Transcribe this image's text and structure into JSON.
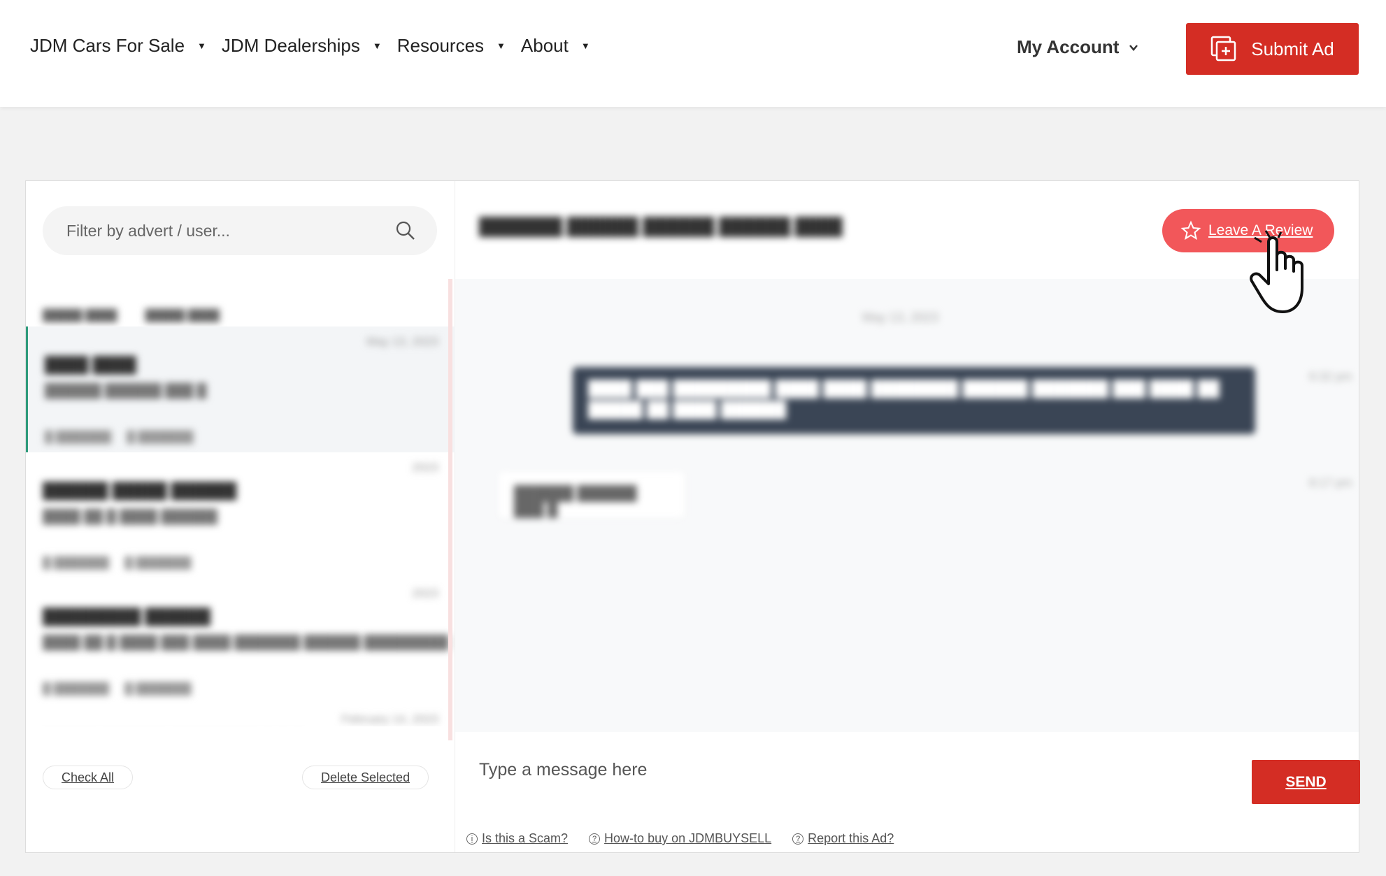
{
  "nav": {
    "items": [
      {
        "label": "JDM Cars For Sale"
      },
      {
        "label": "JDM Dealerships"
      },
      {
        "label": "Resources"
      },
      {
        "label": "About"
      }
    ],
    "account_label": "My Account",
    "submit_label": "Submit Ad"
  },
  "sidebar": {
    "filter_placeholder": "Filter by advert / user...",
    "check_all_label": "Check All",
    "delete_selected_label": "Delete Selected",
    "conversations": [
      {
        "date": "May 13, 2023",
        "active": true
      },
      {
        "date": "2023",
        "active": false
      },
      {
        "date": "2023",
        "active": false
      },
      {
        "date": "February 14, 2023",
        "active": false
      }
    ]
  },
  "chat": {
    "review_label": "Leave A Review",
    "day_separator": "May 13, 2023",
    "outgoing_time": "6:32 pm",
    "incoming_time": "8:17 pm"
  },
  "composer": {
    "placeholder": "Type a message here",
    "send_label": "SEND"
  },
  "footer": {
    "scam_label": "Is this a Scam?",
    "howto_label": " How-to buy on JDMBUYSELL",
    "report_label": "Report this Ad?"
  },
  "colors": {
    "brand_red": "#d42d24",
    "review_pink": "#f2575a",
    "active_accent": "#2e9b7b",
    "bubble_dark": "#3a4555"
  }
}
